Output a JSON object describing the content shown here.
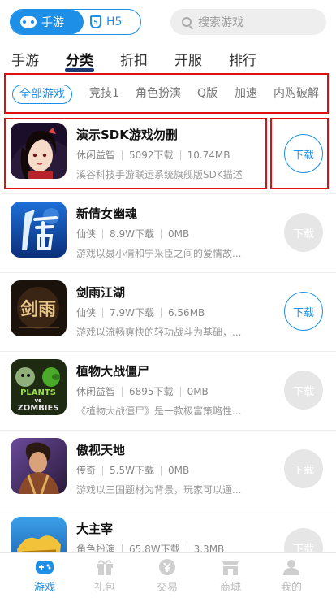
{
  "top": {
    "seg_active": "手游",
    "seg_inactive": "H5",
    "h5_badge": "5",
    "search_placeholder": "搜索游戏"
  },
  "tabs": [
    "手游",
    "分类",
    "折扣",
    "开服",
    "排行"
  ],
  "active_tab": "分类",
  "subcategories": [
    "全部游戏",
    "竞技1",
    "角色扮演",
    "Q版",
    "加速",
    "内购破解"
  ],
  "active_subcategory": "全部游戏",
  "games": [
    {
      "name": "演示SDK游戏勿删",
      "category": "休闲益智",
      "downloads": "5092下载",
      "size": "10.74MB",
      "desc": "溪谷科技手游联运系统旗舰版SDK描述",
      "button": "下载",
      "button_active": true
    },
    {
      "name": "新倩女幽魂",
      "category": "仙侠",
      "downloads": "8.9W下载",
      "size": "0MB",
      "desc": "游戏以聂小倩和宁采臣之间的爱情故...",
      "button": "下载",
      "button_active": false
    },
    {
      "name": "剑雨江湖",
      "category": "仙侠",
      "downloads": "7.9W下载",
      "size": "6.56MB",
      "desc": "游戏以流畅爽快的轻功战斗为基础，...",
      "button": "下载",
      "button_active": true
    },
    {
      "name": "植物大战僵尸",
      "category": "休闲益智",
      "downloads": "6895下载",
      "size": "0MB",
      "desc": "《植物大战僵尸》是一款极富策略性...",
      "button": "下载",
      "button_active": false
    },
    {
      "name": "傲视天地",
      "category": "传奇",
      "downloads": "5.5W下载",
      "size": "0MB",
      "desc": "游戏以三国题材为背景，玩家可以通...",
      "button": "下载",
      "button_active": false
    },
    {
      "name": "大主宰",
      "category": "角色扮演",
      "downloads": "65.8W下载",
      "size": "3.3MB",
      "desc": "",
      "button": "下载",
      "button_active": false
    }
  ],
  "icon_labels": {
    "jianyu": "剑雨",
    "pvz_top": "PLANTS",
    "pvz_mid": "vs",
    "pvz_bottom": "ZOMBIES"
  },
  "bottom_nav": [
    "游戏",
    "礼包",
    "交易",
    "商城",
    "我的"
  ],
  "active_nav": "游戏",
  "colors": {
    "accent": "#1e8fe6",
    "highlight": "#e01010",
    "disabled_button": "#e6e6e6"
  }
}
